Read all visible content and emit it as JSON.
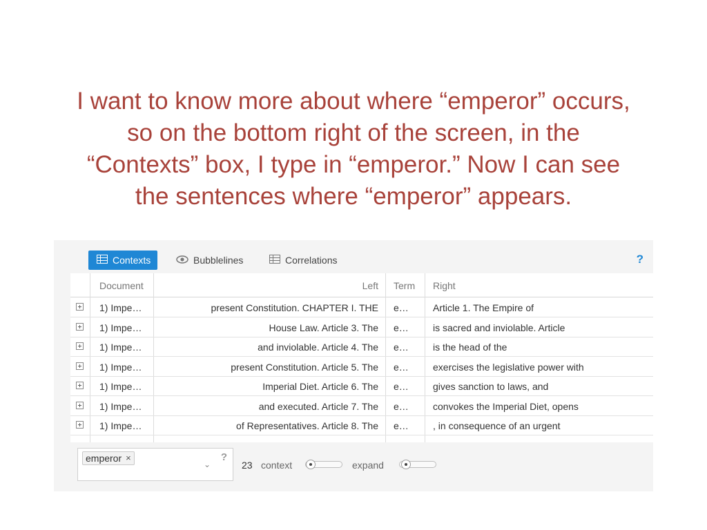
{
  "caption": {
    "line1": "I want to know more about where “emperor” occurs,",
    "line2": "so on the bottom right of the screen, in the",
    "line3": "“Contexts” box, I type in “emperor.” Now I can see",
    "line4": "the sentences where “emperor” appears."
  },
  "colors": {
    "caption": "#a8423a",
    "accent": "#1f87d5"
  },
  "tabs": [
    {
      "label": "Contexts",
      "icon": "grid-icon",
      "active": true
    },
    {
      "label": "Bubblelines",
      "icon": "eye-icon",
      "active": false
    },
    {
      "label": "Correlations",
      "icon": "grid-icon",
      "active": false
    }
  ],
  "help_label": "?",
  "table": {
    "columns": {
      "document": "Document",
      "left": "Left",
      "term": "Term",
      "right": "Right"
    },
    "rows": [
      {
        "document": "1) Impe…",
        "left": "present Constitution. CHAPTER I. THE",
        "term": "e…",
        "right": "Article 1. The Empire of"
      },
      {
        "document": "1) Impe…",
        "left": "House Law. Article 3. The",
        "term": "e…",
        "right": "is sacred and inviolable. Article"
      },
      {
        "document": "1) Impe…",
        "left": "and inviolable. Article 4. The",
        "term": "e…",
        "right": "is the head of the"
      },
      {
        "document": "1) Impe…",
        "left": "present Constitution. Article 5. The",
        "term": "e…",
        "right": "exercises the legislative power with"
      },
      {
        "document": "1) Impe…",
        "left": "Imperial Diet. Article 6. The",
        "term": "e…",
        "right": "gives sanction to laws, and"
      },
      {
        "document": "1) Impe…",
        "left": "and executed. Article 7. The",
        "term": "e…",
        "right": "convokes the Imperial Diet, opens"
      },
      {
        "document": "1) Impe…",
        "left": "of Representatives. Article 8. The",
        "term": "e…",
        "right": ", in consequence of an urgent"
      }
    ]
  },
  "search": {
    "term": "emperor",
    "remove": "×",
    "dropdown": "⌄",
    "help": "?"
  },
  "controls": {
    "count": "23",
    "context_label": "context",
    "expand_label": "expand"
  }
}
